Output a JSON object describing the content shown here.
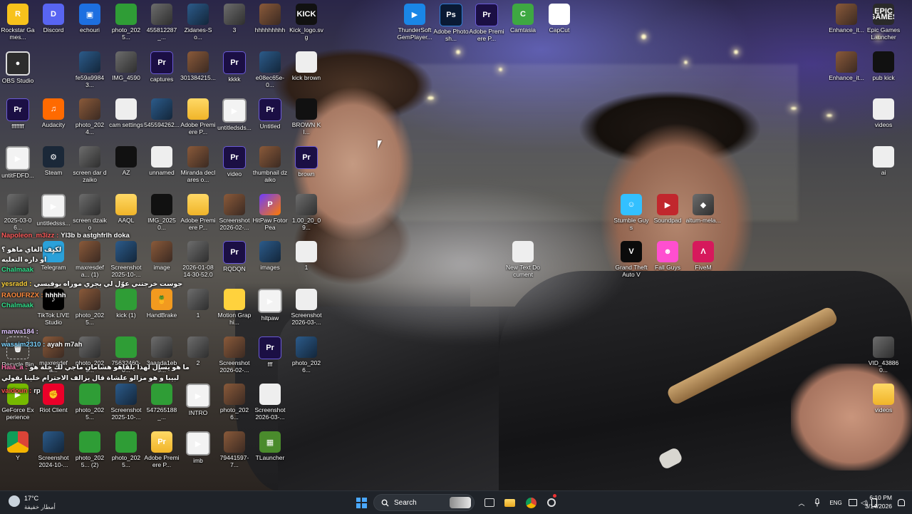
{
  "desktop": {
    "icons": [
      {
        "label": "Rockstar Games...",
        "glyph": "R",
        "kind": "rockstar",
        "icon": "rockstar-games-icon"
      },
      {
        "label": "Discord",
        "glyph": "D",
        "kind": "discord",
        "icon": "discord-icon"
      },
      {
        "label": "echouri",
        "glyph": "▣",
        "kind": "blue",
        "icon": "image-file-icon"
      },
      {
        "label": "photo_2025...",
        "glyph": "",
        "kind": "green",
        "icon": "photo-thumbnail-icon"
      },
      {
        "label": "455812287_...",
        "glyph": "",
        "kind": "photo",
        "icon": "photo-thumbnail-icon"
      },
      {
        "label": "Zidanes-So...",
        "glyph": "",
        "kind": "photo3",
        "icon": "photo-thumbnail-icon"
      },
      {
        "label": "3",
        "glyph": "",
        "kind": "photo",
        "icon": "photo-thumbnail-icon"
      },
      {
        "label": "hhhhhhhhh",
        "glyph": "",
        "kind": "photo2",
        "icon": "photo-thumbnail-icon"
      },
      {
        "label": "Kick_logo.svg",
        "glyph": "KICK",
        "kind": "black",
        "icon": "kick-logo-icon"
      },
      {
        "label": "ThunderSoft GemPlayer...",
        "glyph": "▶",
        "kind": "thunder",
        "icon": "thundersoft-player-icon"
      },
      {
        "label": "Adobe Photosh...",
        "glyph": "Ps",
        "kind": "ps",
        "icon": "photoshop-icon"
      },
      {
        "label": "Adobe Premiere P...",
        "glyph": "Pr",
        "kind": "pr",
        "icon": "premiere-pro-icon"
      },
      {
        "label": "Camtasia",
        "glyph": "C",
        "kind": "camtasia",
        "icon": "camtasia-icon"
      },
      {
        "label": "CapCut",
        "glyph": "✂",
        "kind": "capcut",
        "icon": "capcut-icon"
      },
      {
        "label": "Enhance_it...",
        "glyph": "",
        "kind": "photo2",
        "icon": "photo-thumbnail-icon"
      },
      {
        "label": "Epic Games Launcher",
        "glyph": "EPIC GAMES",
        "kind": "epic",
        "icon": "epic-games-icon"
      },
      {
        "label": "OBS Studio",
        "glyph": "●",
        "kind": "obs",
        "icon": "obs-studio-icon"
      },
      {
        "label": "fe59a99843...",
        "glyph": "",
        "kind": "photo3",
        "icon": "photo-thumbnail-icon"
      },
      {
        "label": "IMG_4590",
        "glyph": "",
        "kind": "photo",
        "icon": "photo-thumbnail-icon"
      },
      {
        "label": "captures",
        "glyph": "Pr",
        "kind": "pr",
        "icon": "premiere-project-icon"
      },
      {
        "label": "301384215...",
        "glyph": "",
        "kind": "photo2",
        "icon": "photo-thumbnail-icon"
      },
      {
        "label": "kkkk",
        "glyph": "Pr",
        "kind": "pr",
        "icon": "premiere-project-icon"
      },
      {
        "label": "e08ec65e-0...",
        "glyph": "",
        "kind": "photo3",
        "icon": "photo-thumbnail-icon"
      },
      {
        "label": "kick brown",
        "glyph": "",
        "kind": "file",
        "icon": "file-icon"
      },
      {
        "label": "Enhance_it...",
        "glyph": "",
        "kind": "photo2",
        "icon": "photo-thumbnail-icon"
      },
      {
        "label": "pub kick",
        "glyph": "",
        "kind": "black",
        "icon": "photo-thumbnail-icon"
      },
      {
        "label": "ffffffff",
        "glyph": "Pr",
        "kind": "pr",
        "icon": "premiere-project-icon"
      },
      {
        "label": "Audacity",
        "glyph": "♫",
        "kind": "audacity",
        "icon": "audacity-icon"
      },
      {
        "label": "photo_2024...",
        "glyph": "",
        "kind": "photo2",
        "icon": "photo-thumbnail-icon"
      },
      {
        "label": "cam settings",
        "glyph": "",
        "kind": "file",
        "icon": "file-icon"
      },
      {
        "label": "545594262...",
        "glyph": "",
        "kind": "photo3",
        "icon": "photo-thumbnail-icon"
      },
      {
        "label": "Adobe Premiere P...",
        "glyph": "",
        "kind": "folder",
        "icon": "folder-icon"
      },
      {
        "label": "untitledsds...",
        "glyph": "▶",
        "kind": "video",
        "icon": "video-file-icon"
      },
      {
        "label": "Untitled",
        "glyph": "Pr",
        "kind": "pr",
        "icon": "premiere-project-icon"
      },
      {
        "label": "BROWN KI...",
        "glyph": "",
        "kind": "black",
        "icon": "photo-thumbnail-icon"
      },
      {
        "label": "videos",
        "glyph": "",
        "kind": "file",
        "icon": "file-icon"
      },
      {
        "label": "untitFDFD...",
        "glyph": "▶",
        "kind": "video",
        "icon": "video-file-icon"
      },
      {
        "label": "Steam",
        "glyph": "⚙",
        "kind": "steam",
        "icon": "steam-icon"
      },
      {
        "label": "screen dar dzaiko",
        "glyph": "",
        "kind": "photo",
        "icon": "photo-thumbnail-icon"
      },
      {
        "label": "AZ",
        "glyph": "",
        "kind": "black",
        "icon": "photo-thumbnail-icon"
      },
      {
        "label": "unnamed",
        "glyph": "",
        "kind": "file",
        "icon": "image-file-icon"
      },
      {
        "label": "Miranda declares o...",
        "glyph": "",
        "kind": "photo2",
        "icon": "photo-thumbnail-icon"
      },
      {
        "label": "video",
        "glyph": "Pr",
        "kind": "pr",
        "icon": "premiere-project-icon"
      },
      {
        "label": "thumbnail dzaiko",
        "glyph": "",
        "kind": "photo2",
        "icon": "photo-thumbnail-icon"
      },
      {
        "label": "brown",
        "glyph": "Pr",
        "kind": "pr",
        "icon": "premiere-project-icon"
      },
      {
        "label": "ai",
        "glyph": "",
        "kind": "file",
        "icon": "file-icon"
      },
      {
        "label": "2025-03-06...",
        "glyph": "",
        "kind": "photo",
        "icon": "photo-thumbnail-icon"
      },
      {
        "label": "untitledsss...",
        "glyph": "▶",
        "kind": "video",
        "icon": "video-file-icon"
      },
      {
        "label": "screen dzaiko",
        "glyph": "",
        "kind": "photo",
        "icon": "photo-thumbnail-icon"
      },
      {
        "label": "AAQL",
        "glyph": "",
        "kind": "folder",
        "icon": "folder-icon"
      },
      {
        "label": "IMG_20250...",
        "glyph": "",
        "kind": "black",
        "icon": "photo-thumbnail-icon"
      },
      {
        "label": "Adobe Premiere P...",
        "glyph": "",
        "kind": "folder",
        "icon": "folder-icon"
      },
      {
        "label": "Screenshot 2026-02-...",
        "glyph": "",
        "kind": "photo2",
        "icon": "photo-thumbnail-icon"
      },
      {
        "label": "HitPaw FotorPea",
        "glyph": "P",
        "kind": "hitpaw",
        "icon": "hitpaw-icon"
      },
      {
        "label": "1.00_20_09...",
        "glyph": "",
        "kind": "photo",
        "icon": "photo-thumbnail-icon"
      },
      {
        "label": "Stumble Guys",
        "glyph": "☺",
        "kind": "stumble",
        "icon": "stumble-guys-icon"
      },
      {
        "label": "Soundpad",
        "glyph": "▶",
        "kind": "soundpad",
        "icon": "soundpad-icon"
      },
      {
        "label": "altum-mela...",
        "glyph": "◆",
        "kind": "photo",
        "icon": "app-icon"
      },
      {
        "label": "Telegram",
        "glyph": "✈",
        "kind": "telegram",
        "icon": "telegram-icon"
      },
      {
        "label": "maxresdefa... (1)",
        "glyph": "",
        "kind": "photo2",
        "icon": "photo-thumbnail-icon"
      },
      {
        "label": "Screenshot 2025-10-...",
        "glyph": "",
        "kind": "photo3",
        "icon": "photo-thumbnail-icon"
      },
      {
        "label": "image",
        "glyph": "",
        "kind": "photo2",
        "icon": "photo-thumbnail-icon"
      },
      {
        "label": "2026-01-08 14-30-52.00...",
        "glyph": "",
        "kind": "photo",
        "icon": "photo-thumbnail-icon"
      },
      {
        "label": "RQDQN",
        "glyph": "Pr",
        "kind": "pr",
        "icon": "premiere-project-icon"
      },
      {
        "label": "images",
        "glyph": "",
        "kind": "photo3",
        "icon": "photo-thumbnail-icon"
      },
      {
        "label": "1",
        "glyph": "",
        "kind": "file",
        "icon": "file-icon"
      },
      {
        "label": "New Text Document",
        "glyph": "",
        "kind": "file",
        "icon": "text-file-icon"
      },
      {
        "label": "Grand Theft Auto V",
        "glyph": "V",
        "kind": "gta",
        "icon": "gta-v-icon"
      },
      {
        "label": "Fall Guys",
        "glyph": "☻",
        "kind": "fallguys",
        "icon": "fall-guys-icon"
      },
      {
        "label": "FiveM",
        "glyph": "Λ",
        "kind": "fivem",
        "icon": "fivem-icon"
      },
      {
        "label": "TikTok LIVE Studio",
        "glyph": "♪",
        "kind": "tiktok",
        "icon": "tiktok-live-icon"
      },
      {
        "label": "photo_2025...",
        "glyph": "",
        "kind": "photo2",
        "icon": "photo-thumbnail-icon"
      },
      {
        "label": "kick (1)",
        "glyph": "",
        "kind": "green",
        "icon": "photo-thumbnail-icon"
      },
      {
        "label": "HandBrake",
        "glyph": "🍍",
        "kind": "handbrake",
        "icon": "handbrake-icon"
      },
      {
        "label": "1",
        "glyph": "",
        "kind": "photo",
        "icon": "photo-thumbnail-icon"
      },
      {
        "label": "Motion Graphi...",
        "glyph": "",
        "kind": "motion",
        "icon": "folder-icon"
      },
      {
        "label": "hitpaw",
        "glyph": "▶",
        "kind": "video",
        "icon": "video-file-icon"
      },
      {
        "label": "Screenshot 2026-03-...",
        "glyph": "",
        "kind": "file",
        "icon": "photo-thumbnail-icon"
      },
      {
        "label": "Recycle Bin",
        "glyph": "🗑",
        "kind": "recycle",
        "icon": "recycle-bin-icon"
      },
      {
        "label": "maxresdefa...",
        "glyph": "",
        "kind": "photo2",
        "icon": "photo-thumbnail-icon"
      },
      {
        "label": "photo_2025...",
        "glyph": "",
        "kind": "photo",
        "icon": "photo-thumbnail-icon"
      },
      {
        "label": "75632460-0...",
        "glyph": "",
        "kind": "green",
        "icon": "photo-thumbnail-icon"
      },
      {
        "label": "3aaada1eb5...",
        "glyph": "",
        "kind": "photo",
        "icon": "photo-thumbnail-icon"
      },
      {
        "label": "2",
        "glyph": "",
        "kind": "photo",
        "icon": "photo-thumbnail-icon"
      },
      {
        "label": "Screenshot 2026-02-...",
        "glyph": "",
        "kind": "photo2",
        "icon": "photo-thumbnail-icon"
      },
      {
        "label": "fff",
        "glyph": "Pr",
        "kind": "pr",
        "icon": "premiere-project-icon"
      },
      {
        "label": "photo_2026...",
        "glyph": "",
        "kind": "photo3",
        "icon": "photo-thumbnail-icon"
      },
      {
        "label": "VID_438860...",
        "glyph": "",
        "kind": "photo",
        "icon": "photo-thumbnail-icon"
      },
      {
        "label": "GeForce Experience",
        "glyph": "▶",
        "kind": "geforce",
        "icon": "geforce-icon"
      },
      {
        "label": "Riot Client",
        "glyph": "✊",
        "kind": "riot",
        "icon": "riot-client-icon"
      },
      {
        "label": "photo_2025...",
        "glyph": "",
        "kind": "green",
        "icon": "photo-thumbnail-icon"
      },
      {
        "label": "Screenshot 2025-10-...",
        "glyph": "",
        "kind": "photo3",
        "icon": "photo-thumbnail-icon"
      },
      {
        "label": "547265188_...",
        "glyph": "",
        "kind": "green",
        "icon": "photo-thumbnail-icon"
      },
      {
        "label": "INTRO",
        "glyph": "▶",
        "kind": "video",
        "icon": "video-file-icon"
      },
      {
        "label": "photo_2026...",
        "glyph": "",
        "kind": "photo2",
        "icon": "photo-thumbnail-icon"
      },
      {
        "label": "Screenshot 2026-03-...",
        "glyph": "",
        "kind": "file",
        "icon": "photo-thumbnail-icon"
      },
      {
        "label": "videos",
        "glyph": "",
        "kind": "folder",
        "icon": "folder-icon"
      },
      {
        "label": "Y",
        "glyph": "",
        "kind": "chrome",
        "icon": "chrome-icon"
      },
      {
        "label": "Screenshot 2024-10-...",
        "glyph": "",
        "kind": "photo3",
        "icon": "photo-thumbnail-icon"
      },
      {
        "label": "photo_2025... (2)",
        "glyph": "",
        "kind": "green",
        "icon": "photo-thumbnail-icon"
      },
      {
        "label": "photo_2025...",
        "glyph": "",
        "kind": "green",
        "icon": "photo-thumbnail-icon"
      },
      {
        "label": "Adobe Premiere P...",
        "glyph": "Pr",
        "kind": "folder",
        "icon": "folder-icon"
      },
      {
        "label": "imb",
        "glyph": "▶",
        "kind": "video",
        "icon": "video-file-icon"
      },
      {
        "label": "79441597-7...",
        "glyph": "",
        "kind": "photo2",
        "icon": "photo-thumbnail-icon"
      },
      {
        "label": "TLauncher",
        "glyph": "▦",
        "kind": "tlaunch",
        "icon": "tlauncher-icon"
      }
    ]
  },
  "chat": [
    {
      "user": "Napoleon_m3izz :",
      "msg": "Yl3b b astghfrlh doka",
      "color": "#ff5b5b"
    },
    {
      "user": "",
      "msg": "لكيف الغاي ماهو ؟",
      "color": "#ffffff"
    },
    {
      "user": "",
      "msg": "او داره التعليه",
      "color": "#ffffff"
    },
    {
      "user": "Chalmaak",
      "msg": "",
      "color": "#31e28d"
    },
    {
      "user": "yesradd :",
      "msg": "جوست خرجتني عوّل لي يجري موراه يوقيسي",
      "color": "#ffd43b"
    },
    {
      "user": "RAOUFRZX :",
      "msg": "hhhhh",
      "color": "#ff8a3d"
    },
    {
      "user": "Chalmaak",
      "msg": "",
      "color": "#31e28d"
    },
    {
      "user": "marwa184 :",
      "msg": "",
      "color": "#e0c4ff"
    },
    {
      "user": "wassim2310 :",
      "msg": "ayah m7ah",
      "color": "#7ad3ff"
    },
    {
      "user": "Haia_a :",
      "msg": "ما هو يسال لهذا يلقاهو هشامان ماجي لك خلة هو",
      "color": "#ff6ea8"
    },
    {
      "user": "",
      "msg": "لبيبا و هو مزالو علشاة قال يزالف الاحترام خلينا يقولي",
      "color": "#ffffff"
    },
    {
      "user": "vaidoun :",
      "msg": "rp",
      "color": "#ff4e4e"
    }
  ],
  "taskbar": {
    "weather_temp": "17°C",
    "weather_desc": "أمطار خفيفة",
    "search_label": "Search",
    "language": "ENG",
    "time": "6:10 PM",
    "date": "3/14/2026"
  }
}
